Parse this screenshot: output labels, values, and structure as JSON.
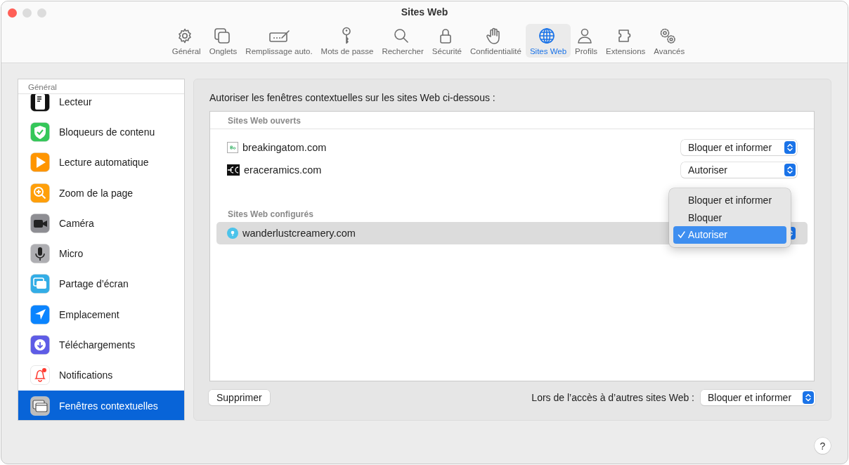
{
  "window": {
    "title": "Sites Web"
  },
  "toolbar": [
    {
      "label": "Général",
      "selected": false
    },
    {
      "label": "Onglets",
      "selected": false
    },
    {
      "label": "Remplissage auto.",
      "selected": false
    },
    {
      "label": "Mots de passe",
      "selected": false
    },
    {
      "label": "Rechercher",
      "selected": false
    },
    {
      "label": "Sécurité",
      "selected": false
    },
    {
      "label": "Confidentialité",
      "selected": false
    },
    {
      "label": "Sites Web",
      "selected": true
    },
    {
      "label": "Profils",
      "selected": false
    },
    {
      "label": "Extensions",
      "selected": false
    },
    {
      "label": "Avancés",
      "selected": false
    }
  ],
  "sidebar": {
    "header": "Général",
    "items": [
      {
        "label": "Lecteur",
        "selected": false
      },
      {
        "label": "Bloqueurs de contenu",
        "selected": false
      },
      {
        "label": "Lecture automatique",
        "selected": false
      },
      {
        "label": "Zoom de la page",
        "selected": false
      },
      {
        "label": "Caméra",
        "selected": false
      },
      {
        "label": "Micro",
        "selected": false
      },
      {
        "label": "Partage d’écran",
        "selected": false
      },
      {
        "label": "Emplacement",
        "selected": false
      },
      {
        "label": "Téléchargements",
        "selected": false
      },
      {
        "label": "Notifications",
        "selected": false
      },
      {
        "label": "Fenêtres contextuelles",
        "selected": true
      }
    ]
  },
  "panel": {
    "heading": "Autoriser les fenêtres contextuelles sur les sites Web ci-dessous :",
    "sections": [
      {
        "title": "Sites Web ouverts",
        "sites": [
          {
            "name": "breakingatom.com",
            "setting": "Bloquer et informer",
            "selected": false
          },
          {
            "name": "eraceramics.com",
            "setting": "Autoriser",
            "selected": false
          }
        ]
      },
      {
        "title": "Sites Web configurés",
        "sites": [
          {
            "name": "wanderlustcreamery.com",
            "selected": true,
            "menu": [
              {
                "label": "Bloquer et informer",
                "checked": false
              },
              {
                "label": "Bloquer",
                "checked": false
              },
              {
                "label": "Autoriser",
                "checked": true
              }
            ]
          }
        ]
      }
    ],
    "remove_button": "Supprimer",
    "other_sites_label": "Lors de l’accès à d’autres sites Web :",
    "other_sites_setting": "Bloquer et informer"
  },
  "help_button": "?"
}
